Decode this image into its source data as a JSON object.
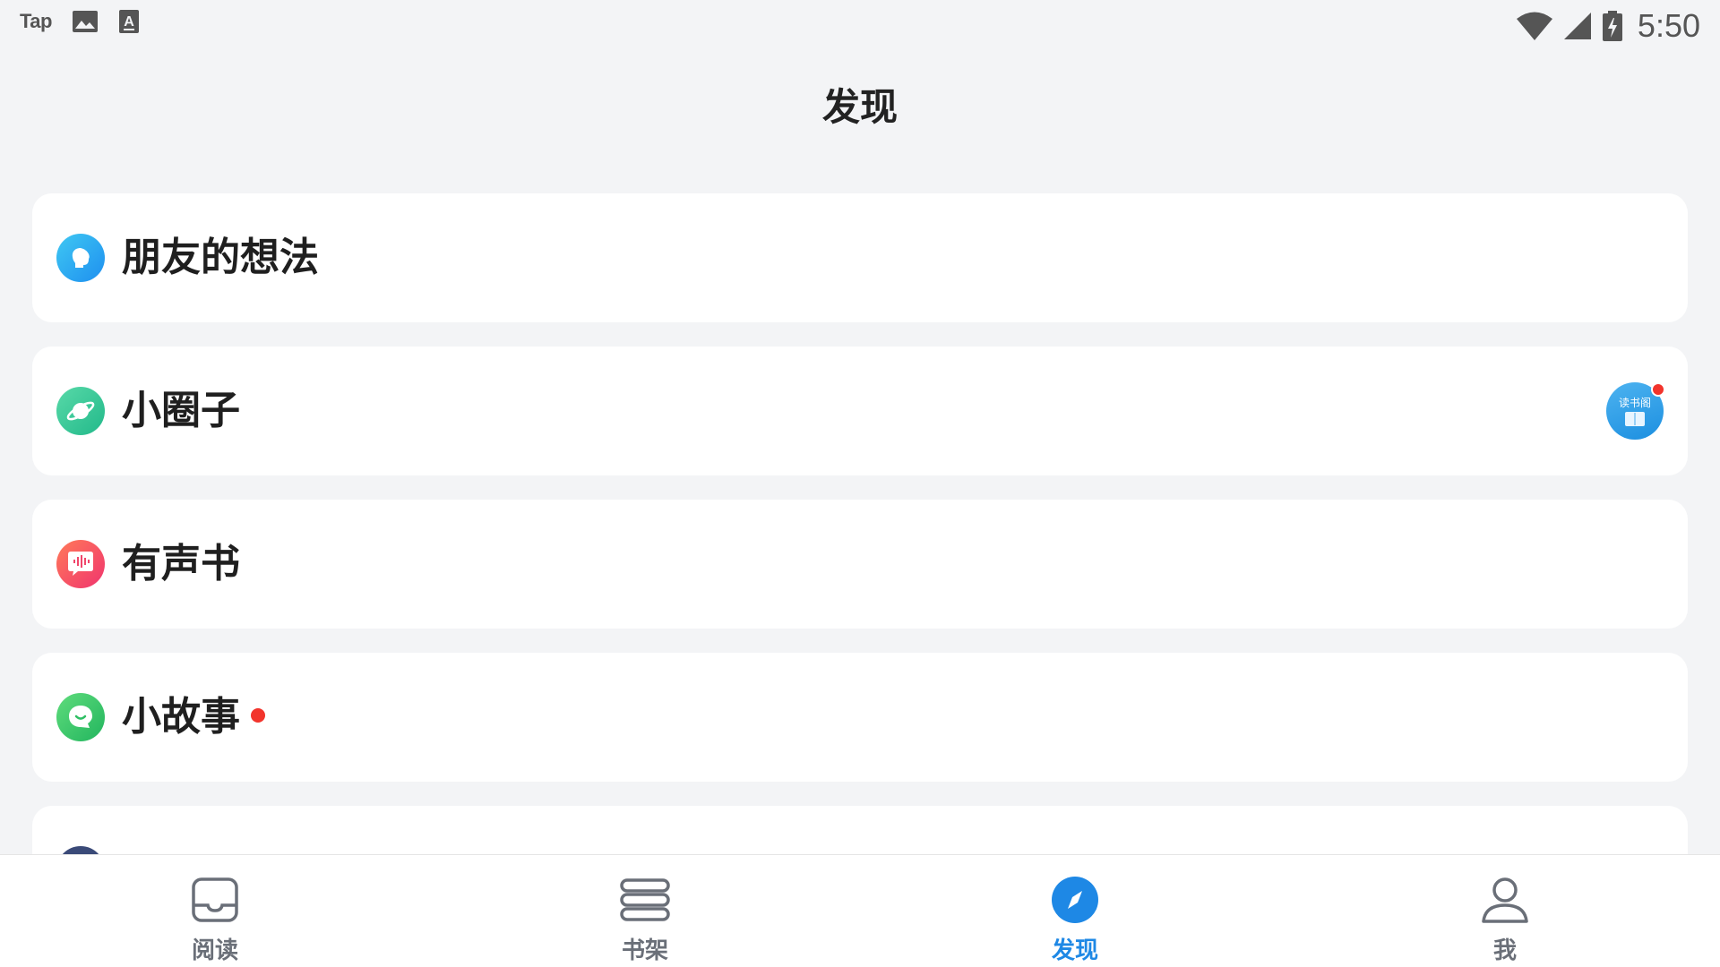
{
  "status_bar": {
    "app_label": "Tap",
    "time": "5:50",
    "icons": [
      "image-icon",
      "keyboard-a-icon",
      "wifi-icon",
      "cell-signal-icon",
      "battery-charging-icon"
    ]
  },
  "page": {
    "title": "发现"
  },
  "items": [
    {
      "label": "朋友的想法",
      "icon": "person-head-icon",
      "color": "#2aa7ef"
    },
    {
      "label": "小圈子",
      "icon": "planet-icon",
      "color": "#34c79a",
      "badge_text": "读书阁"
    },
    {
      "label": "有声书",
      "icon": "audio-wave-icon",
      "color": "#f2466b"
    },
    {
      "label": "小故事",
      "icon": "chat-bubble-icon",
      "color": "#3ccc6a",
      "has_red_dot": true
    },
    {
      "label": "",
      "icon": "partial-icon",
      "color": "#3a4a78"
    }
  ],
  "bottom_nav": [
    {
      "label": "阅读",
      "icon": "reader-icon",
      "active": false
    },
    {
      "label": "书架",
      "icon": "bookshelf-icon",
      "active": false
    },
    {
      "label": "发现",
      "icon": "compass-icon",
      "active": true
    },
    {
      "label": "我",
      "icon": "person-icon",
      "active": false
    }
  ],
  "colors": {
    "accent": "#1e88e5",
    "red_dot": "#f2342c",
    "background": "#f3f4f6"
  }
}
